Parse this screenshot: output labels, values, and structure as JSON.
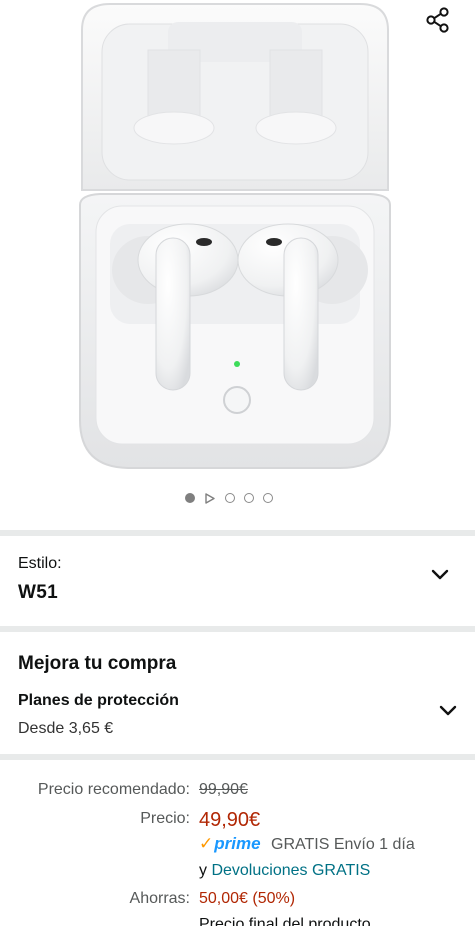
{
  "carousel": {
    "image_alt": "",
    "dot_count": 5,
    "active_index": 0
  },
  "icons": {
    "share": "share-icon",
    "video": "play-icon",
    "expand": "chevron-down-icon",
    "prime_check": "prime-check-icon"
  },
  "style": {
    "label": "Estilo:",
    "value": "W51"
  },
  "upgrade": {
    "title": "Mejora tu compra",
    "plans_title": "Planes de protección",
    "plans_from": "Desde 3,65 €"
  },
  "pricing": {
    "list_label": "Precio recomendado:",
    "list_value": "99,90€",
    "price_label": "Precio:",
    "price_value": "49,90€",
    "prime_text": "prime",
    "shipping_text": "GRATIS Envío 1 día",
    "returns_prefix": "y",
    "returns_link": "Devoluciones GRATIS",
    "savings_label": "Ahorras:",
    "savings_value": "50,00€ (50%)",
    "footnote": "Precio final del producto"
  },
  "colors": {
    "price": "#b12704",
    "link": "#007185",
    "prime": "#1a98ff",
    "prime_check": "#ff9900",
    "divider": "#e8eaea"
  }
}
